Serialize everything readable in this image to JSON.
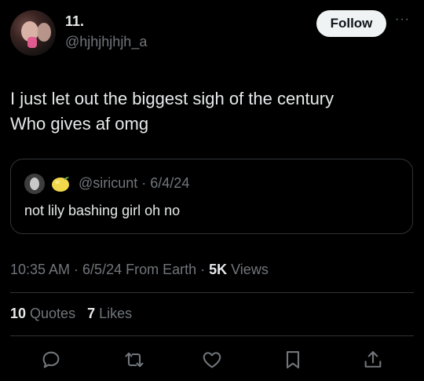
{
  "author": {
    "name": "11.",
    "handle": "@hjhjhjhjh_a"
  },
  "follow_label": "Follow",
  "more_label": "···",
  "tweet": {
    "line1": "I just let out the biggest sigh of the century",
    "line2": "Who gives af omg"
  },
  "quote": {
    "handle_date": "@siricunt · 6/4/24",
    "text": "not lily bashing girl oh no"
  },
  "meta": {
    "time_date_loc": "10:35 AM · 6/5/24 From Earth · ",
    "views_count": "5K",
    "views_label": " Views"
  },
  "stats": {
    "quotes_count": "10",
    "quotes_label": " Quotes",
    "likes_count": "7",
    "likes_label": " Likes"
  },
  "actions": [
    "reply-icon",
    "retweet-icon",
    "like-icon",
    "bookmark-icon",
    "share-icon"
  ],
  "colors": {
    "background": "#000000",
    "text": "#e7e9ea",
    "secondary": "#71767b",
    "border": "#2f3336",
    "follow_bg": "#eff3f4"
  }
}
